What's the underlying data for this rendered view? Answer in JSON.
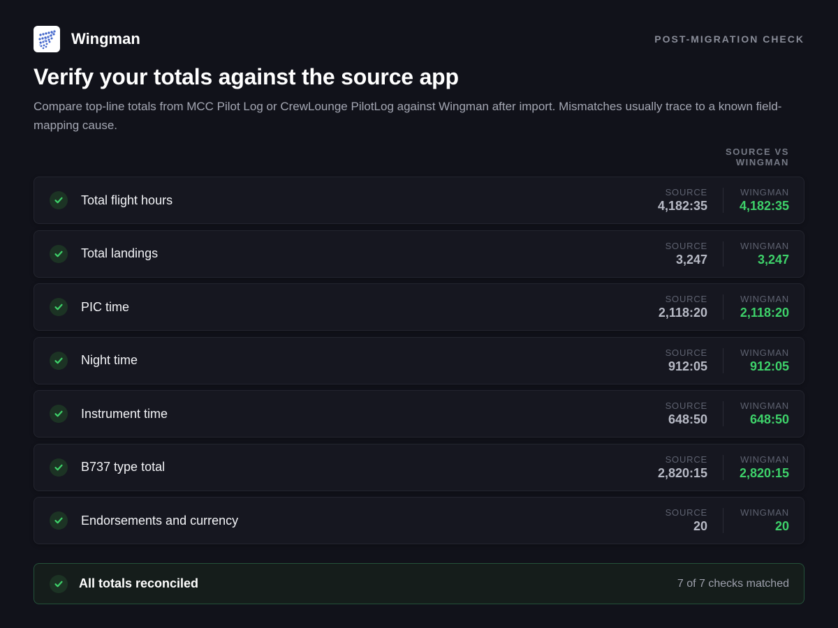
{
  "app": {
    "name": "Wingman",
    "logo_icon": "wingman-logo"
  },
  "header": {
    "eyebrow": "POST-MIGRATION CHECK"
  },
  "page": {
    "title": "Verify your totals against the source app",
    "subtitle": "Compare top-line totals from MCC Pilot Log or CrewLounge PilotLog against Wingman after import. Mismatches usually trace to a known field-mapping cause."
  },
  "column_heading": "SOURCE VS WINGMAN",
  "labels": {
    "source": "SOURCE",
    "wingman": "WINGMAN"
  },
  "rows": [
    {
      "label": "Total flight hours",
      "source": "4,182:35",
      "wingman": "4,182:35",
      "status": "matched"
    },
    {
      "label": "Total landings",
      "source": "3,247",
      "wingman": "3,247",
      "status": "matched"
    },
    {
      "label": "PIC time",
      "source": "2,118:20",
      "wingman": "2,118:20",
      "status": "matched"
    },
    {
      "label": "Night time",
      "source": "912:05",
      "wingman": "912:05",
      "status": "matched"
    },
    {
      "label": "Instrument time",
      "source": "648:50",
      "wingman": "648:50",
      "status": "matched"
    },
    {
      "label": "B737 type total",
      "source": "2,820:15",
      "wingman": "2,820:15",
      "status": "matched"
    },
    {
      "label": "Endorsements and currency",
      "source": "20",
      "wingman": "20",
      "status": "matched"
    }
  ],
  "summary": {
    "title": "All totals reconciled",
    "count": "7 of 7 checks matched"
  },
  "colors": {
    "match_green": "#3ed26a",
    "background": "#11121a",
    "card": "#161720"
  },
  "icons": {
    "row_status": "check-icon",
    "summary_status": "check-icon"
  }
}
